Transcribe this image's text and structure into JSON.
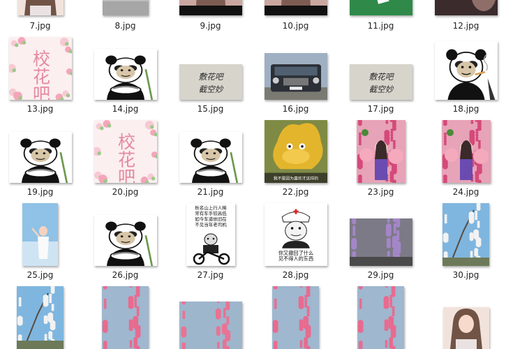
{
  "files": [
    {
      "name": "7.jpg",
      "kind": "girl-photo"
    },
    {
      "name": "8.jpg",
      "kind": "gray-photo"
    },
    {
      "name": "9.jpg",
      "kind": "girl-dark-photo"
    },
    {
      "name": "10.jpg",
      "kind": "girl-dark-photo"
    },
    {
      "name": "11.jpg",
      "kind": "green-table-photo"
    },
    {
      "name": "12.jpg",
      "kind": "dark-photo"
    },
    {
      "name": "13.jpg",
      "kind": "flower-card"
    },
    {
      "name": "14.jpg",
      "kind": "panda-noodles"
    },
    {
      "name": "15.jpg",
      "kind": "calligraphy"
    },
    {
      "name": "16.jpg",
      "kind": "jeep"
    },
    {
      "name": "17.jpg",
      "kind": "calligraphy"
    },
    {
      "name": "18.jpg",
      "kind": "panda-smoking"
    },
    {
      "name": "19.jpg",
      "kind": "panda-noodles"
    },
    {
      "name": "20.jpg",
      "kind": "flower-card"
    },
    {
      "name": "21.jpg",
      "kind": "panda-noodles"
    },
    {
      "name": "22.jpg",
      "kind": "duck-meme"
    },
    {
      "name": "23.jpg",
      "kind": "pig-photo"
    },
    {
      "name": "24.jpg",
      "kind": "pig-photo"
    },
    {
      "name": "25.jpg",
      "kind": "sky-girl"
    },
    {
      "name": "26.jpg",
      "kind": "panda-noodles"
    },
    {
      "name": "27.jpg",
      "kind": "panda-motorbike"
    },
    {
      "name": "28.jpg",
      "kind": "nurse-meme"
    },
    {
      "name": "29.jpg",
      "kind": "wisteria"
    },
    {
      "name": "30.jpg",
      "kind": "blossom-sky"
    },
    {
      "name": "",
      "kind": "blossom-sky"
    },
    {
      "name": "",
      "kind": "pink-blossom"
    },
    {
      "name": "",
      "kind": "pink-blossom-wide"
    },
    {
      "name": "",
      "kind": "pink-blossom"
    },
    {
      "name": "",
      "kind": "pink-blossom"
    },
    {
      "name": "",
      "kind": "girl-photo"
    }
  ],
  "meme_text": {
    "flower_card": "校花吧",
    "calligraphy_line1": "敷花吧",
    "calligraphy_line2": "截空妙",
    "motorbike_lines": [
      "秋名山上行人稀",
      "常有车手较高低",
      "如今车道依旧在",
      "不见当年老司机"
    ],
    "nurse_lines": [
      "你又撤回了什么",
      "见不得人的东西"
    ],
    "duck_caption": "我不是因为喜欢才这样的"
  },
  "colors": {
    "background": "#ffffff",
    "caption": "#222222"
  }
}
